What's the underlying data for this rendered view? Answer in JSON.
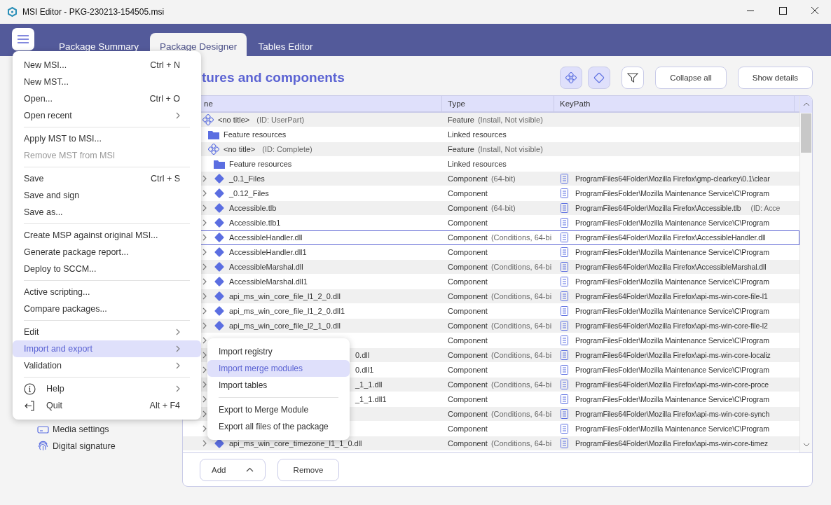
{
  "window": {
    "title": "MSI Editor - PKG-230213-154505.msi"
  },
  "tabs": [
    {
      "label": "Package Summary",
      "selected": false
    },
    {
      "label": "Package Designer",
      "selected": true
    },
    {
      "label": "Tables Editor",
      "selected": false
    }
  ],
  "sidebar": {
    "items": [
      {
        "label": "Media settings",
        "kind": "media"
      },
      {
        "label": "Digital signature",
        "kind": "signature"
      }
    ]
  },
  "heading": "tures and components",
  "toolbar": {
    "toggles": [
      {
        "kind": "features",
        "selected": true
      },
      {
        "kind": "components",
        "selected": true
      },
      {
        "kind": "filter",
        "selected": false
      }
    ],
    "buttons": [
      "Collapse all",
      "Show details"
    ]
  },
  "table": {
    "columns": [
      "ne",
      "Type",
      "KeyPath"
    ],
    "rows": [
      {
        "kind": "feature",
        "name": "<no title>",
        "id": "(ID: UserPart)",
        "type": "Feature",
        "type_detail": "(Install, Not visible)",
        "selected": false,
        "children": [
          {
            "kind": "resources",
            "name": "Feature resources",
            "type": "Linked resources",
            "selected": false
          },
          {
            "kind": "feature",
            "name": "<no title>",
            "id": "(ID: Complete)",
            "type": "Feature",
            "type_detail": "(Install, Not visible)",
            "selected": false,
            "children": [
              {
                "kind": "resources",
                "name": "Feature resources",
                "type": "Linked resources",
                "selected": false
              },
              {
                "kind": "component",
                "name": "_0.1_Files",
                "type": "Component",
                "type_detail": "(64-bit)",
                "keypath": "ProgramFiles64Folder\\Mozilla Firefox\\gmp-clearkey\\0.1\\clear",
                "selected": false
              },
              {
                "kind": "component",
                "name": "_0.12_Files",
                "type": "Component",
                "keypath": "ProgramFilesFolder\\Mozilla Maintenance Service\\C\\Program",
                "selected": false
              },
              {
                "kind": "component",
                "name": "Accessible.tlb",
                "type": "Component",
                "type_detail": "(64-bit)",
                "keypath": "ProgramFiles64Folder\\Mozilla Firefox\\Accessible.tlb",
                "keypath_detail": "(ID: Acce",
                "selected": false
              },
              {
                "kind": "component",
                "name": "Accessible.tlb1",
                "type": "Component",
                "keypath": "ProgramFilesFolder\\Mozilla Maintenance Service\\C\\Program",
                "selected": false
              },
              {
                "kind": "component",
                "name": "AccessibleHandler.dll",
                "type": "Component",
                "type_detail": "(Conditions, 64-bi",
                "keypath": "ProgramFiles64Folder\\Mozilla Firefox\\AccessibleHandler.dll",
                "selected": true
              },
              {
                "kind": "component",
                "name": "AccessibleHandler.dll1",
                "type": "Component",
                "keypath": "ProgramFilesFolder\\Mozilla Maintenance Service\\C\\Program",
                "selected": false
              },
              {
                "kind": "component",
                "name": "AccessibleMarshal.dll",
                "type": "Component",
                "type_detail": "(Conditions, 64-bi",
                "keypath": "ProgramFiles64Folder\\Mozilla Firefox\\AccessibleMarshal.dll",
                "selected": false
              },
              {
                "kind": "component",
                "name": "AccessibleMarshal.dll1",
                "type": "Component",
                "keypath": "ProgramFilesFolder\\Mozilla Maintenance Service\\C\\Program",
                "selected": false
              },
              {
                "kind": "component",
                "name": "api_ms_win_core_file_l1_2_0.dll",
                "type": "Component",
                "type_detail": "(Conditions, 64-bi",
                "keypath": "ProgramFiles64Folder\\Mozilla Firefox\\api-ms-win-core-file-l1",
                "selected": false
              },
              {
                "kind": "component",
                "name": "api_ms_win_core_file_l1_2_0.dll1",
                "type": "Component",
                "keypath": "ProgramFilesFolder\\Mozilla Maintenance Service\\C\\Program",
                "selected": false
              },
              {
                "kind": "component",
                "name": "api_ms_win_core_file_l2_1_0.dll",
                "type": "Component",
                "type_detail": "(Conditions, 64-bi",
                "keypath": "ProgramFiles64Folder\\Mozilla Firefox\\api-ms-win-core-file-l2",
                "selected": false
              },
              {
                "kind": "component_hidden",
                "type": "Component",
                "keypath": "ProgramFilesFolder\\Mozilla Maintenance Service\\C\\Program",
                "selected": false
              },
              {
                "kind": "component_covered",
                "name": "0.dll",
                "type": "Component",
                "type_detail": "(Conditions, 64-bi",
                "keypath": "ProgramFiles64Folder\\Mozilla Firefox\\api-ms-win-core-localiz",
                "selected": false
              },
              {
                "kind": "component_covered",
                "name": "0.dll1",
                "type": "Component",
                "keypath": "ProgramFilesFolder\\Mozilla Maintenance Service\\C\\Program",
                "selected": false
              },
              {
                "kind": "component_covered",
                "name": "_1_1.dll",
                "type": "Component",
                "type_detail": "(Conditions, 64-bi",
                "keypath": "ProgramFiles64Folder\\Mozilla Firefox\\api-ms-win-core-proce",
                "selected": false
              },
              {
                "kind": "component_covered",
                "name": "_1_1.dll1",
                "type": "Component",
                "keypath": "ProgramFilesFolder\\Mozilla Maintenance Service\\C\\Program",
                "selected": false
              },
              {
                "kind": "component_hidden",
                "type": "Component",
                "type_detail": "(Conditions, 64-bi",
                "keypath": "ProgramFiles64Folder\\Mozilla Firefox\\api-ms-win-core-synch",
                "selected": false
              },
              {
                "kind": "component_hidden",
                "type": "Component",
                "keypath": "ProgramFilesFolder\\Mozilla Maintenance Service\\C\\Program",
                "selected": false
              },
              {
                "kind": "component",
                "name": "api_ms_win_core_timezone_l1_1_0.dll",
                "type": "Component",
                "type_detail": "(Conditions, 64-bi",
                "keypath": "ProgramFiles64Folder\\Mozilla Firefox\\api-ms-win-core-timez",
                "selected": false
              }
            ]
          }
        ]
      }
    ]
  },
  "bottom_buttons": [
    {
      "label": "Add",
      "kind": "dropdown"
    },
    {
      "label": "Remove",
      "kind": "plain"
    }
  ],
  "menu": {
    "items": [
      {
        "kind": "item",
        "label": "New MSI...",
        "shortcut": "Ctrl + N",
        "disabled": false,
        "selected": false
      },
      {
        "kind": "item",
        "label": "New MST...",
        "disabled": false,
        "selected": false
      },
      {
        "kind": "item",
        "label": "Open...",
        "shortcut": "Ctrl + O",
        "disabled": false,
        "selected": false
      },
      {
        "kind": "submenu",
        "label": "Open recent",
        "disabled": false,
        "selected": false
      },
      {
        "kind": "separator"
      },
      {
        "kind": "item",
        "label": "Apply MST to MSI...",
        "disabled": false,
        "selected": false
      },
      {
        "kind": "item",
        "label": "Remove MST from MSI",
        "disabled": true,
        "selected": false
      },
      {
        "kind": "separator"
      },
      {
        "kind": "item",
        "label": "Save",
        "shortcut": "Ctrl + S",
        "disabled": false,
        "selected": false
      },
      {
        "kind": "item",
        "label": "Save and sign",
        "disabled": false,
        "selected": false
      },
      {
        "kind": "item",
        "label": "Save as...",
        "disabled": false,
        "selected": false
      },
      {
        "kind": "separator"
      },
      {
        "kind": "item",
        "label": "Create MSP against original MSI...",
        "disabled": false,
        "selected": false
      },
      {
        "kind": "item",
        "label": "Generate package report...",
        "disabled": false,
        "selected": false
      },
      {
        "kind": "item",
        "label": "Deploy to SCCM...",
        "disabled": false,
        "selected": false
      },
      {
        "kind": "separator"
      },
      {
        "kind": "item",
        "label": "Active scripting...",
        "disabled": false,
        "selected": false
      },
      {
        "kind": "item",
        "label": "Compare packages...",
        "disabled": false,
        "selected": false
      },
      {
        "kind": "separator"
      },
      {
        "kind": "submenu",
        "label": "Edit",
        "disabled": false,
        "selected": false
      },
      {
        "kind": "submenu",
        "label": "Import and export",
        "disabled": false,
        "selected": true
      },
      {
        "kind": "submenu",
        "label": "Validation",
        "disabled": false,
        "selected": false
      },
      {
        "kind": "separator"
      },
      {
        "kind": "info_submenu",
        "label": "Help",
        "disabled": false,
        "selected": false
      },
      {
        "kind": "exit_item",
        "label": "Quit",
        "shortcut": "Alt + F4",
        "disabled": false,
        "selected": false
      }
    ]
  },
  "submenu": {
    "items": [
      {
        "kind": "item",
        "label": "Import registry",
        "selected": false
      },
      {
        "kind": "item",
        "label": "Import merge modules",
        "selected": true
      },
      {
        "kind": "item",
        "label": "Import tables",
        "selected": false
      },
      {
        "kind": "separator"
      },
      {
        "kind": "item",
        "label": "Export to Merge Module",
        "selected": false
      },
      {
        "kind": "item",
        "label": "Export all files of the package",
        "selected": false
      }
    ]
  }
}
